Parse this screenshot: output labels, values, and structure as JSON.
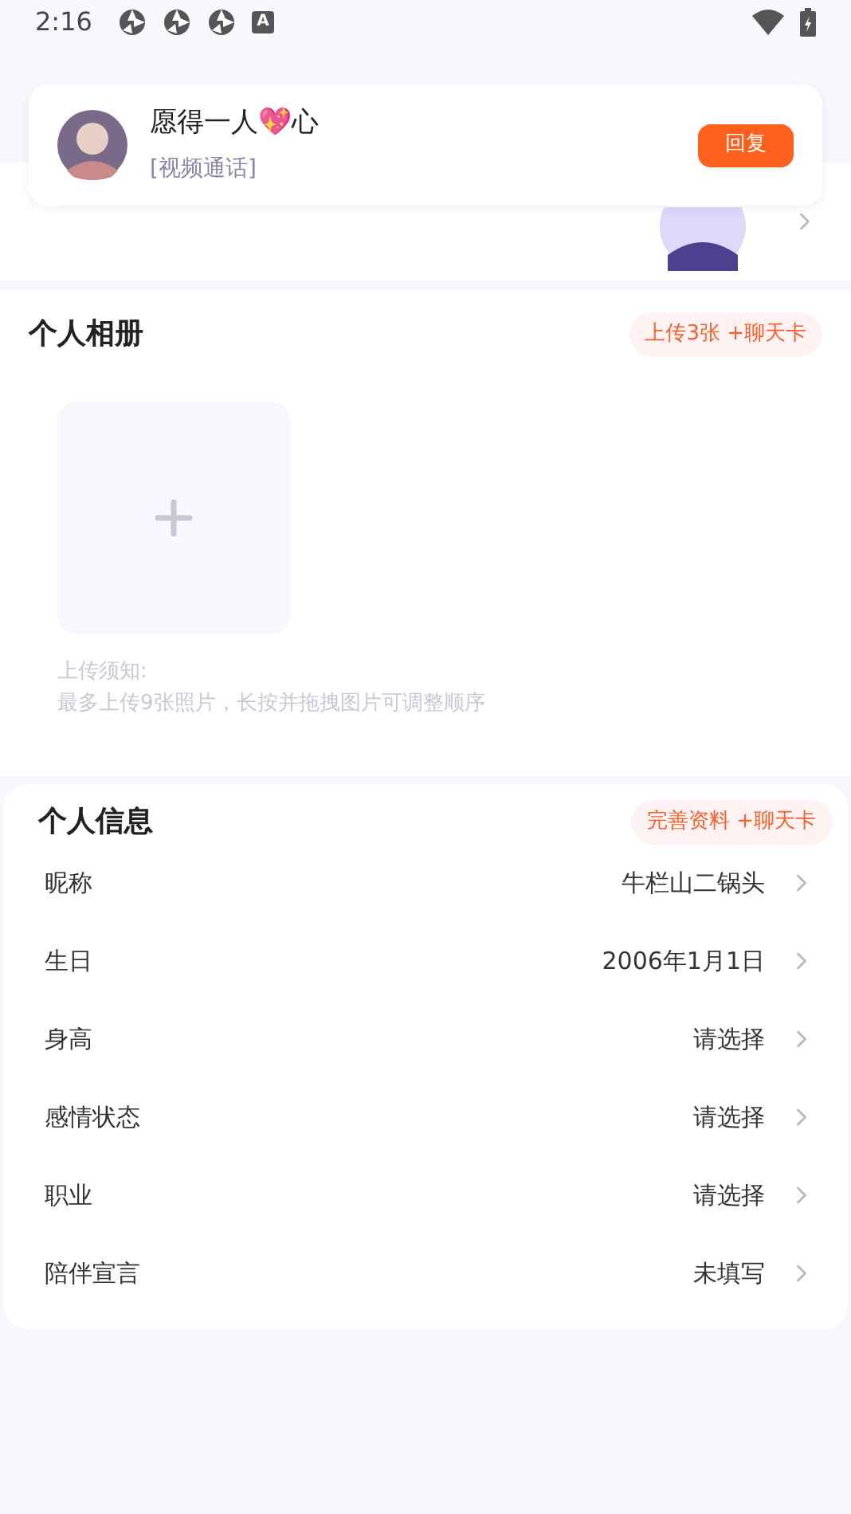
{
  "status_bar": {
    "time": "2:16",
    "badge": "A"
  },
  "notification": {
    "name": "愿得一人💖心",
    "message": "[视频通话]",
    "reply_button": "回复"
  },
  "album": {
    "title": "个人相册",
    "reward": "上传3张 +聊天卡",
    "upload_hint_title": "上传须知:",
    "upload_hint": "最多上传9张照片，长按并拖拽图片可调整顺序"
  },
  "info": {
    "title": "个人信息",
    "reward": "完善资料 +聊天卡",
    "rows": [
      {
        "label": "昵称",
        "value": "牛栏山二锅头"
      },
      {
        "label": "生日",
        "value": "2006年1月1日"
      },
      {
        "label": "身高",
        "value": "请选择"
      },
      {
        "label": "感情状态",
        "value": "请选择"
      },
      {
        "label": "职业",
        "value": "请选择"
      },
      {
        "label": "陪伴宣言",
        "value": "未填写"
      }
    ]
  }
}
